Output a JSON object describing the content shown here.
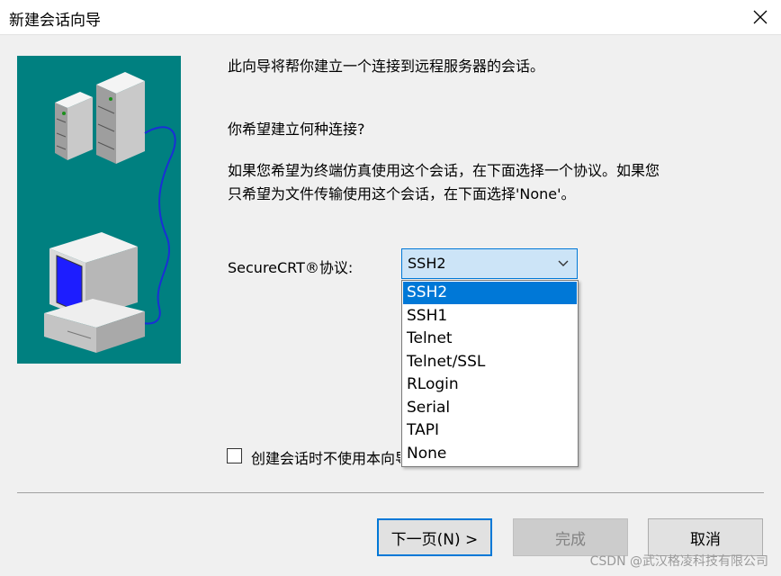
{
  "window": {
    "title": "新建会话向导",
    "close_icon": "close-icon"
  },
  "intro": "此向导将帮你建立一个连接到远程服务器的会话。",
  "question": "你希望建立何种连接?",
  "help_line1": "如果您希望为终端仿真使用这个会话，在下面选择一个协议。如果您",
  "help_line2": "只希望为文件传输使用这个会话，在下面选择'None'。",
  "protocol": {
    "label": "SecureCRT®协议:",
    "selected": "SSH2",
    "options": [
      "SSH2",
      "SSH1",
      "Telnet",
      "Telnet/SSL",
      "RLogin",
      "Serial",
      "TAPI",
      "None"
    ]
  },
  "checkbox": {
    "label": "创建会话时不使用本向导",
    "checked": false
  },
  "buttons": {
    "next": "下一页(N) >",
    "finish": "完成",
    "cancel": "取消"
  },
  "watermark": "CSDN @武汉格凌科技有限公司",
  "colors": {
    "accent": "#0078d7",
    "illustration_bg": "#008080",
    "selected_bg": "#cce4f7"
  }
}
